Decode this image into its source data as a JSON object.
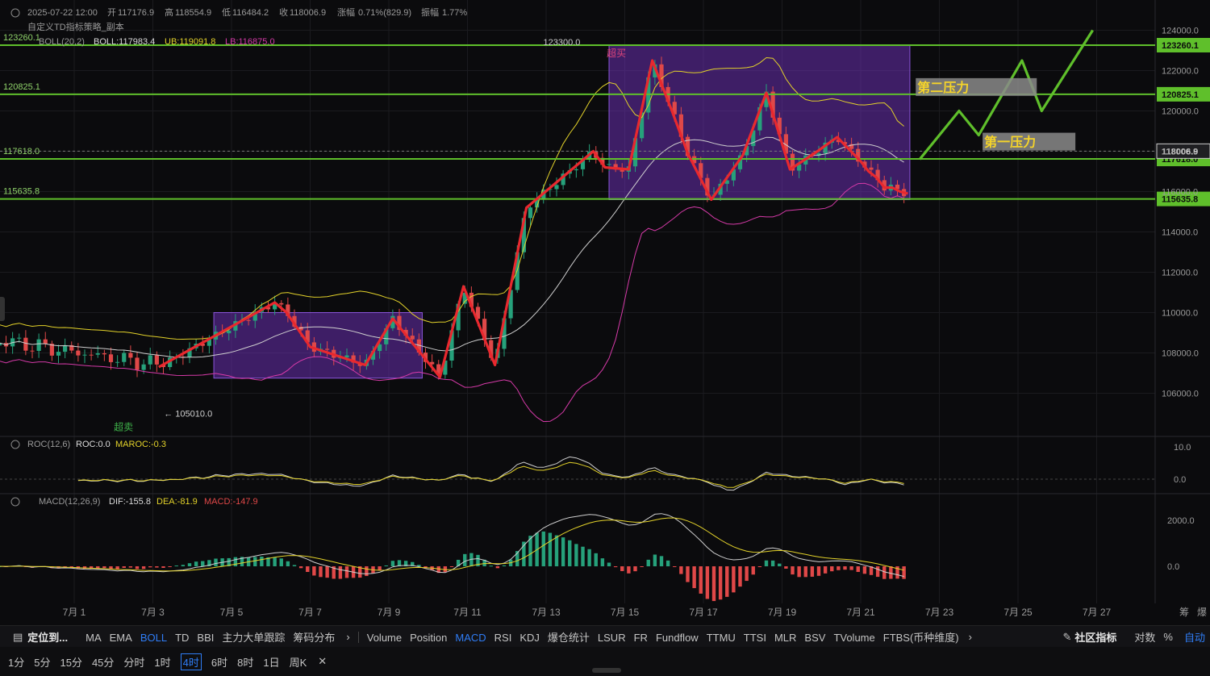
{
  "header": {
    "date": "2025-07-22 12:00",
    "open_label": "开",
    "open": "117176.9",
    "high_label": "高",
    "high": "118554.9",
    "low_label": "低",
    "low": "116484.2",
    "close_label": "收",
    "close": "118006.9",
    "change_label": "涨幅",
    "change": "0.71%(829.9)",
    "amp_label": "振幅",
    "amp": "1.77%",
    "strategy": "自定义TD指标策略_副本",
    "boll_name": "BOLL(20,2)",
    "boll_val": "BOLL:117983.4",
    "ub_val": "UB:119091.8",
    "lb_val": "LB:116875.0"
  },
  "roc": {
    "name": "ROC(12,6)",
    "val": "ROC:0.0",
    "ma": "MAROC:-0.3",
    "axis": [
      "10.0",
      "0.0"
    ]
  },
  "macd": {
    "name": "MACD(12,26,9)",
    "dif": "DIF:-155.8",
    "dea": "DEA:-81.9",
    "macd": "MACD:-147.9",
    "axis": [
      "2000.0",
      "0.0"
    ]
  },
  "levels": {
    "l1": "123260.1",
    "l2": "120825.1",
    "l3": "117618.0",
    "l4": "115635.8",
    "last": "118006.9",
    "hi_mark": "123300.0",
    "lo_mark": "105010.0",
    "overbuy": "超买",
    "oversell": "超卖",
    "res1": "第一压力",
    "res2": "第二压力"
  },
  "price_axis": [
    "124000.0",
    "122000.0",
    "120000.0",
    "118000.0",
    "116000.0",
    "114000.0",
    "112000.0",
    "110000.0",
    "108000.0",
    "106000.0"
  ],
  "date_axis": [
    "7月 1",
    "7月 3",
    "7月 5",
    "7月 7",
    "7月 9",
    "7月 11",
    "7月 13",
    "7月 15",
    "7月 17",
    "7月 19",
    "7月 21",
    "7月 23",
    "7月 25",
    "7月 27"
  ],
  "corner": [
    "筹",
    "爆"
  ],
  "toolbar": {
    "locate": "定位到...",
    "main": [
      "MA",
      "EMA",
      "BOLL",
      "TD",
      "BBI",
      "主力大单跟踪",
      "筹码分布"
    ],
    "main_active": "BOLL",
    "sub": [
      "Volume",
      "Position",
      "MACD",
      "RSI",
      "KDJ",
      "爆仓统计",
      "LSUR",
      "FR",
      "Fundflow",
      "TTMU",
      "TTSI",
      "MLR",
      "BSV",
      "TVolume",
      "FTBS(币种维度)"
    ],
    "sub_active": "MACD",
    "community": "社区指标",
    "log": "对数",
    "pct": "%",
    "auto": "自动"
  },
  "timeframes": [
    "1分",
    "5分",
    "15分",
    "45分",
    "分时",
    "1时",
    "4时",
    "6时",
    "8时",
    "1日",
    "周K"
  ],
  "timeframe_active": "4时",
  "colors": {
    "up": "#26a17b",
    "down": "#e04848",
    "boll_mid": "#cfcfcf",
    "boll_ub": "#e3d22a",
    "boll_lb": "#d63aa8",
    "zigzag": "#e8282e",
    "level": "#5fbf2b",
    "box": "#6a2fb0",
    "proj": "#5fbf2b",
    "accent": "#2f7df6"
  },
  "chart_data": {
    "type": "candlestick",
    "timeframe": "4h",
    "x_range": [
      "2025-06-30",
      "2025-07-27"
    ],
    "ylim": [
      104500,
      124500
    ],
    "horizontal_levels": [
      123260.1,
      120825.1,
      117618.0,
      115635.8
    ],
    "zigzag": [
      [
        3.15,
        107300
      ],
      [
        6.1,
        110500
      ],
      [
        6.4,
        110000
      ],
      [
        7.0,
        108300
      ],
      [
        8.4,
        107400
      ],
      [
        9.1,
        109700
      ],
      [
        10.3,
        106800
      ],
      [
        10.9,
        111300
      ],
      [
        11.7,
        107400
      ],
      [
        12.5,
        115200
      ],
      [
        14.2,
        118000
      ],
      [
        14.5,
        117200
      ],
      [
        15.1,
        117100
      ],
      [
        15.7,
        122500
      ],
      [
        16.2,
        120000
      ],
      [
        16.6,
        117900
      ],
      [
        17.2,
        115600
      ],
      [
        18.0,
        117800
      ],
      [
        18.6,
        120900
      ],
      [
        19.2,
        117100
      ],
      [
        19.9,
        118000
      ],
      [
        20.4,
        118700
      ],
      [
        21.0,
        117500
      ],
      [
        21.2,
        117000
      ],
      [
        21.4,
        116700
      ],
      [
        21.6,
        116200
      ],
      [
        21.8,
        116200
      ],
      [
        22.0,
        116000
      ],
      [
        22.2,
        115900
      ]
    ],
    "projection": [
      [
        22.5,
        117600
      ],
      [
        23.5,
        120000
      ],
      [
        24.0,
        118800
      ],
      [
        25.1,
        122500
      ],
      [
        25.6,
        120000
      ],
      [
        26.9,
        124000
      ]
    ],
    "annotations": {
      "high": 123300.0,
      "low": 105010.0,
      "first_resistance": "第一压力",
      "second_resistance": "第二压力"
    }
  }
}
